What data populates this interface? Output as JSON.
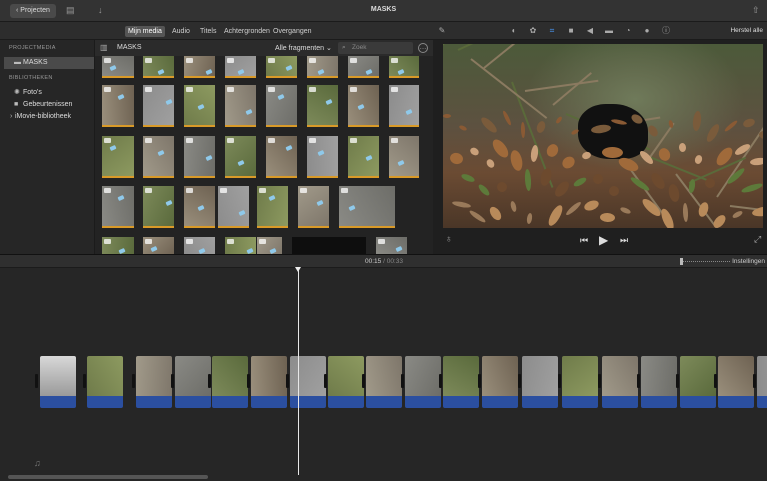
{
  "window": {
    "title": "MASKS",
    "back_label": "Projecten"
  },
  "tabs": [
    {
      "label": "Mijn media",
      "active": true
    },
    {
      "label": "Audio"
    },
    {
      "label": "Titels"
    },
    {
      "label": "Achtergronden"
    },
    {
      "label": "Overgangen"
    }
  ],
  "viewer_tools": [
    "balance-icon",
    "color-icon",
    "crop-icon",
    "stabilize-icon",
    "volume-icon",
    "noise-icon",
    "speed-icon",
    "filter-icon",
    "info-icon"
  ],
  "reset_label": "Herstel alle",
  "sidebar": {
    "project_heading": "PROJECTMEDIA",
    "project_item": "MASKS",
    "library_heading": "BIBLIOTHEKEN",
    "library_items": [
      "Foto's",
      "Gebeurtenissen",
      "iMovie-bibliotheek"
    ]
  },
  "browser": {
    "title": "MASKS",
    "filter": "Alle fragmenten",
    "search_placeholder": "Zoek"
  },
  "timeline": {
    "current_time": "00:15",
    "total_time": "/ 00:33",
    "settings_label": "Instellingen"
  },
  "colors": {
    "accent": "#4a9cff",
    "audio": "#2b4fa0",
    "thumb_border": "#d99a28"
  }
}
